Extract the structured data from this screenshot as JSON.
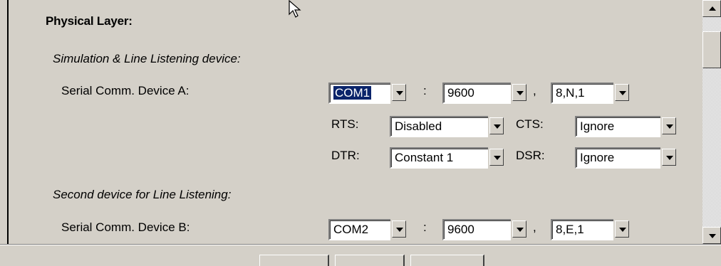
{
  "section": {
    "title": "Physical Layer:"
  },
  "simulation": {
    "heading": "Simulation & Line Listening device:",
    "device_a_label": "Serial Comm. Device A:",
    "port": "COM1",
    "baud": "9600",
    "frame": "8,N,1",
    "rts_label": "RTS:",
    "rts_value": "Disabled",
    "cts_label": "CTS:",
    "cts_value": "Ignore",
    "dtr_label": "DTR:",
    "dtr_value": "Constant 1",
    "dsr_label": "DSR:",
    "dsr_value": "Ignore"
  },
  "second": {
    "heading": "Second device for Line Listening:",
    "device_b_label": "Serial Comm. Device B:",
    "port": "COM2",
    "baud": "9600",
    "frame": "8,E,1"
  },
  "separators": {
    "colon": ":",
    "comma": ","
  },
  "colors": {
    "background": "#d4d0c8",
    "selection": "#0a246a"
  }
}
